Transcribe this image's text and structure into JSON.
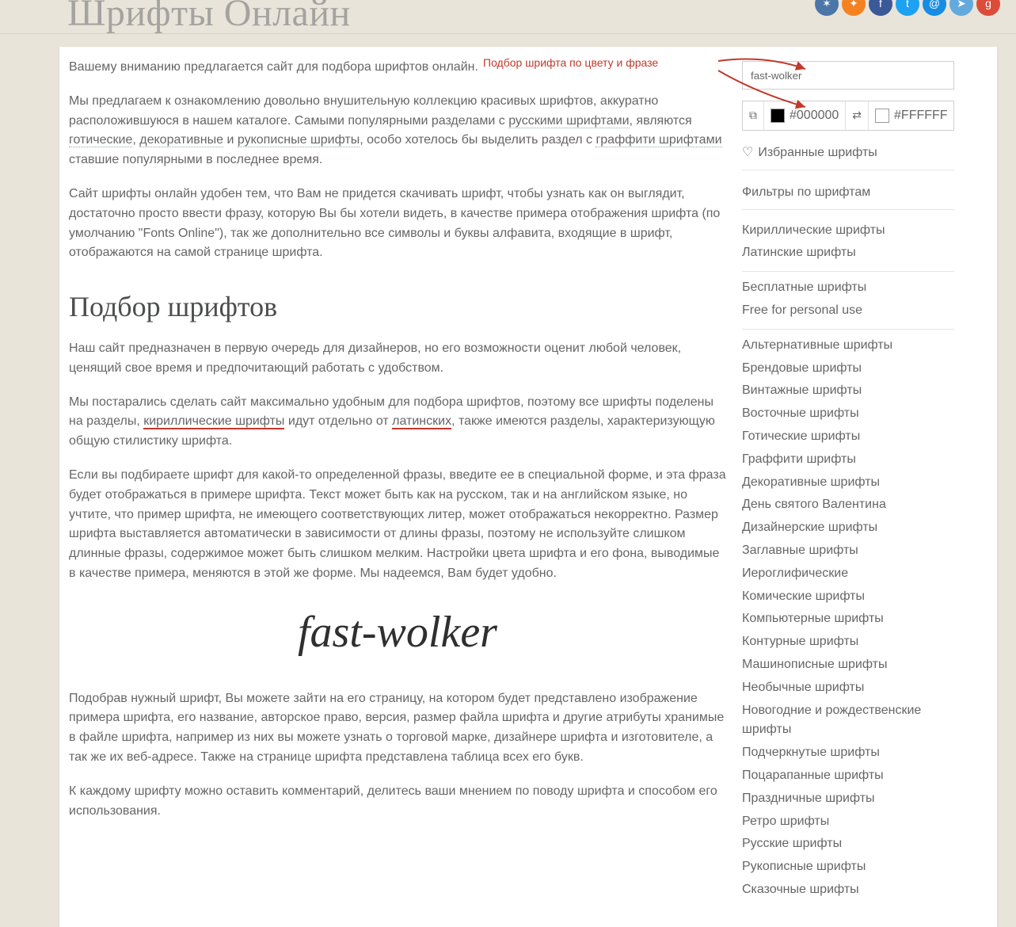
{
  "header": {
    "title_shadow": "Шрифты Онлайн"
  },
  "annotation": {
    "text": "Подбор шрифта по цвету и фразе"
  },
  "socials": [
    {
      "name": "vk",
      "color": "#4a76a8",
      "glyph": "✶"
    },
    {
      "name": "ok",
      "color": "#f58220",
      "glyph": "✦"
    },
    {
      "name": "fb",
      "color": "#3b5998",
      "glyph": "f"
    },
    {
      "name": "tw",
      "color": "#1da1f2",
      "glyph": "t"
    },
    {
      "name": "mail",
      "color": "#168de2",
      "glyph": "@"
    },
    {
      "name": "tg",
      "color": "#64a9dc",
      "glyph": "➤"
    },
    {
      "name": "gp",
      "color": "#dd4b39",
      "glyph": "g"
    }
  ],
  "main": {
    "p1": "Вашему вниманию предлагается сайт для подбора шрифтов онлайн.",
    "p2a": "Мы предлагаем к ознакомлению довольно внушительную коллекцию красивых шрифтов, аккуратно расположившуюся в нашем каталоге. Самыми популярными разделами с ",
    "p2_link1": "русскими шрифтами",
    "p2b": ", являются ",
    "p2_link2": "готические",
    "p2c": ", ",
    "p2_link3": "декоративные",
    "p2d": " и ",
    "p2_link4": "рукописные шрифты",
    "p2e": ", особо хотелось бы выделить раздел с ",
    "p2_link5": "граффити шрифтами",
    "p2f": " ставшие популярными в последнее время.",
    "p3": "Сайт шрифты онлайн удобен тем, что Вам не придется скачивать шрифт, чтобы узнать как он выглядит, достаточно просто ввести фразу, которую Вы бы хотели видеть, в качестве примера отображения шрифта (по умолчанию \"Fonts Online\"), так же дополнительно все символы и буквы алфавита, входящие в шрифт, отображаются на самой странице шрифта.",
    "h2": "Подбор шрифтов",
    "p4": "Наш сайт предназначен в первую очередь для дизайнеров, но его возможности оценит любой человек, ценящий свое время и предпочитающий работать с удобством.",
    "p5a": "Мы постарались сделать сайт максимально удобным для подбора шрифтов, поэтому все шрифты поделены на разделы, ",
    "p5_red1": "кириллические шрифты",
    "p5b": " идут отдельно от ",
    "p5_red2": "латинских",
    "p5c": ", также имеются разделы, характеризующую общую стилистику шрифта.",
    "p6": "Если вы подбираете шрифт для какой-то определенной фразы, введите ее в специальной форме, и эта фраза будет отображаться в примере шрифта. Текст может быть как на русском, так и на английском языке, но учтите, что пример шрифта, не имеющего соответствующих литер, может отображаться некорректно. Размер шрифта выставляется автоматически в зависимости от длины фразы, поэтому не используйте слишком длинные фразы, содержимое может быть слишком мелким. Настройки цвета шрифта и его фона, выводимые в качестве примера, меняются в этой же форме. Мы надеемся, Вам будет удобно.",
    "sample": "fast-wolker",
    "p7": "Подобрав нужный шрифт, Вы можете зайти на его страницу, на котором будет представлено изображение примера шрифта, его название, авторское право, версия, размер файла шрифта и другие атрибуты хранимые в файле шрифта, например из них вы можете узнать о торговой марке, дизайнере шрифта и изготовителе, а так же их веб-адресе. Также на странице шрифта представлена таблица всех его букв.",
    "p8": "К каждому шрифту можно оставить комментарий, делитесь ваши мнением по поводу шрифта и способом его использования."
  },
  "side": {
    "search_value": "fast-wolker",
    "color_fg": "#000000",
    "color_bg": "#FFFFFF",
    "fav": "Избранные шрифты",
    "filters": "Фильтры по шрифтам",
    "group_scripts": [
      "Кириллические шрифты",
      "Латинские шрифты"
    ],
    "group_price": [
      "Бесплатные шрифты",
      "Free for personal use"
    ],
    "group_cats": [
      "Альтернативные шрифты",
      "Брендовые шрифты",
      "Винтажные шрифты",
      "Восточные шрифты",
      "Готические шрифты",
      "Граффити шрифты",
      "Декоративные шрифты",
      "День святого Валентина",
      "Дизайнерские шрифты",
      "Заглавные шрифты",
      "Иероглифические",
      "Комические шрифты",
      "Компьютерные шрифты",
      "Контурные шрифты",
      "Машинописные шрифты",
      "Необычные шрифты",
      "Новогодние и рождественские шрифты",
      "Подчеркнутые шрифты",
      "Поцарапанные шрифты",
      "Праздничные шрифты",
      "Ретро шрифты",
      "Русские шрифты",
      "Рукописные шрифты",
      "Сказочные шрифты"
    ]
  }
}
